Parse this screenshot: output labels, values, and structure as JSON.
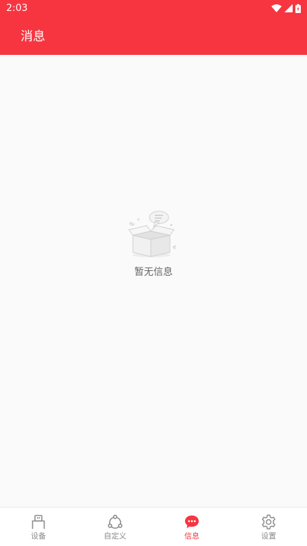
{
  "status_bar": {
    "time": "2:03"
  },
  "app_bar": {
    "title": "消息"
  },
  "empty_state": {
    "text": "暂无信息",
    "icon": "empty-box-icon"
  },
  "bottom_nav": {
    "items": [
      {
        "label": "设备",
        "icon": "device-icon",
        "active": false
      },
      {
        "label": "自定义",
        "icon": "custom-icon",
        "active": false
      },
      {
        "label": "信息",
        "icon": "message-icon",
        "active": true
      },
      {
        "label": "设置",
        "icon": "gear-icon",
        "active": false
      }
    ]
  },
  "colors": {
    "accent": "#f73541",
    "inactive": "#8a8a8a",
    "background": "#fafafa"
  }
}
